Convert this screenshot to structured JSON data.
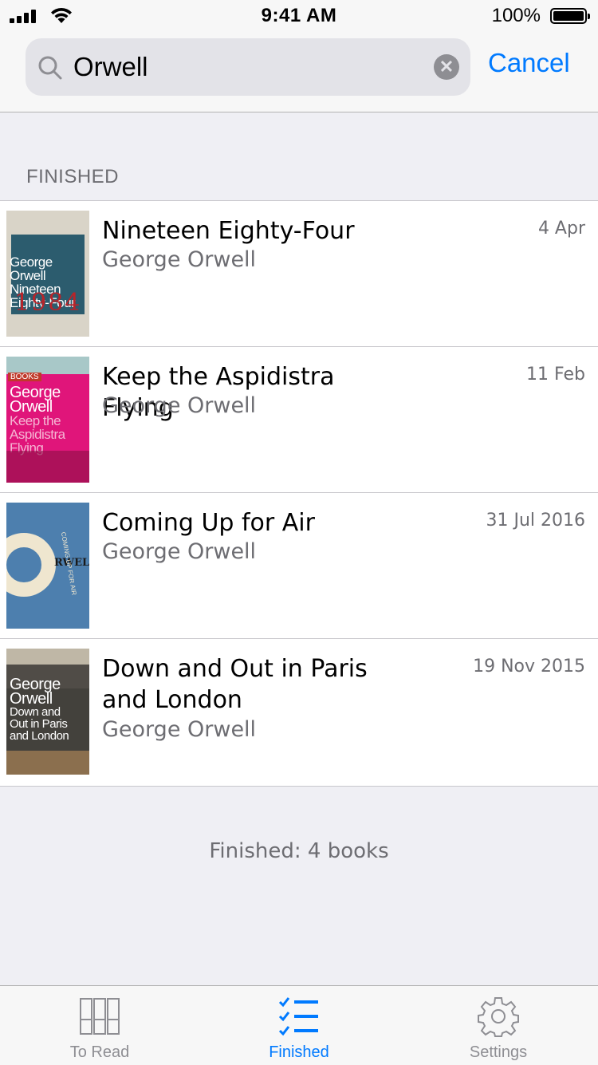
{
  "status_bar": {
    "time": "9:41 AM",
    "battery": "100%"
  },
  "search": {
    "value": "Orwell",
    "cancel_label": "Cancel"
  },
  "section": {
    "header": "FINISHED"
  },
  "books": [
    {
      "title": "Nineteen Eighty-Four",
      "author": "George Orwell",
      "date": "4 Apr",
      "cover": {
        "color": "#2c5c6e",
        "lines": [
          "George",
          "Orwell",
          "Nineteen",
          "Eighty-Four"
        ],
        "mark": "1984"
      }
    },
    {
      "title": "Keep the Aspidistra Flying",
      "author": "George Orwell",
      "date": "11 Feb",
      "cover": {
        "color": "#e0157a",
        "lines": [
          "George",
          "Orwell",
          "Keep the",
          "Aspidistra",
          "Flying"
        ],
        "mark": "BOOKS"
      }
    },
    {
      "title": "Coming Up for Air",
      "author": "George Orwell",
      "date": "31 Jul 2016",
      "cover": {
        "color": "#4d7fae",
        "lines": [],
        "mark": "RWELL",
        "side": "COMING UP FOR AIR"
      }
    },
    {
      "title": "Down and Out in Paris and London",
      "author": "George Orwell",
      "date": "19 Nov 2015",
      "cover": {
        "color": "#3c3a36",
        "lines": [
          "George",
          "Orwell",
          "Down and",
          "Out in Paris",
          "and London"
        ],
        "mark": ""
      }
    }
  ],
  "footer": {
    "count_text": "Finished: 4 books"
  },
  "tabs": [
    {
      "label": "To Read",
      "icon": "books-icon",
      "active": false
    },
    {
      "label": "Finished",
      "icon": "checklist-icon",
      "active": true
    },
    {
      "label": "Settings",
      "icon": "gear-icon",
      "active": false
    }
  ],
  "colors": {
    "accent": "#007aff",
    "secondary_text": "#6d6d72",
    "background": "#efeff4"
  }
}
